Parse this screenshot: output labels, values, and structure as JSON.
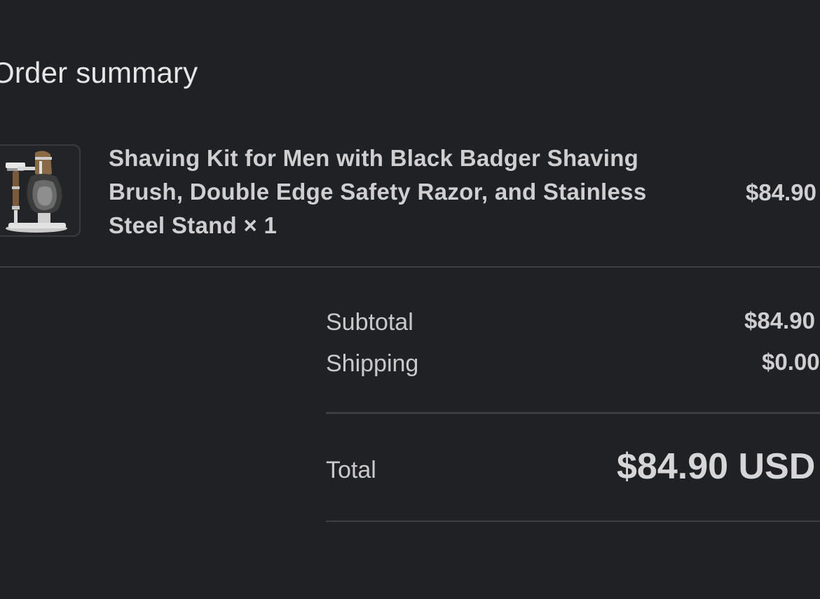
{
  "summary": {
    "title": "Order summary"
  },
  "item": {
    "name": "Shaving Kit for Men with Black Badger Shaving Brush, Double Edge Safety Razor, and Stainless Steel Stand × 1",
    "price": "$84.90",
    "image_icon": "shaving-kit-thumbnail"
  },
  "totals": {
    "subtotal_label": "Subtotal",
    "subtotal_value": "$84.90",
    "shipping_label": "Shipping",
    "shipping_value": "$0.00",
    "total_label": "Total",
    "total_value": "$84.90 USD"
  },
  "colors": {
    "background": "#202125",
    "text": "#cfcfd2",
    "divider": "#3d3e43"
  }
}
